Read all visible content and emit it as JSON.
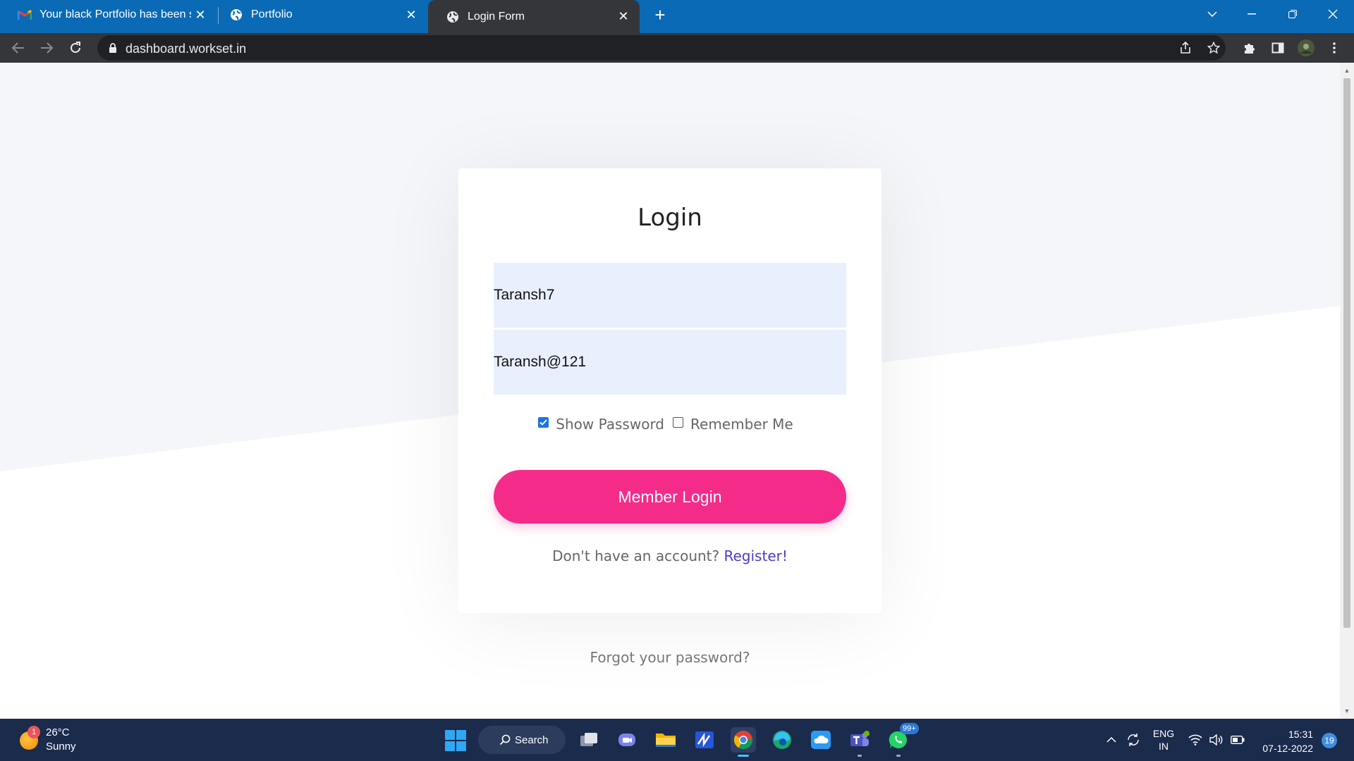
{
  "browser": {
    "tabs": [
      {
        "title": "Your black Portfolio has been suc",
        "icon": "gmail-icon",
        "active": false
      },
      {
        "title": "Portfolio",
        "icon": "globe-icon",
        "active": false
      },
      {
        "title": "Login Form",
        "icon": "globe-icon",
        "active": true
      }
    ],
    "new_tab_label": "+",
    "url": "dashboard.workset.in"
  },
  "login": {
    "title": "Login",
    "username_value": "Taransh7",
    "password_value": "Taransh@121",
    "show_password_label": "Show Password",
    "show_password_checked": true,
    "remember_me_label": "Remember Me",
    "remember_me_checked": false,
    "submit_label": "Member Login",
    "register_prompt": "Don't have an account?",
    "register_link": "Register!",
    "forgot_password": "Forgot your password?",
    "accent_color": "#f52b8a",
    "link_color": "#4a3cc8"
  },
  "taskbar": {
    "weather_temp": "26°C",
    "weather_condition": "Sunny",
    "weather_badge": "1",
    "search_label": "Search",
    "whatsapp_badge": "99+",
    "language_line1": "ENG",
    "language_line2": "IN",
    "time": "15:31",
    "date": "07-12-2022",
    "notification_count": "19"
  }
}
